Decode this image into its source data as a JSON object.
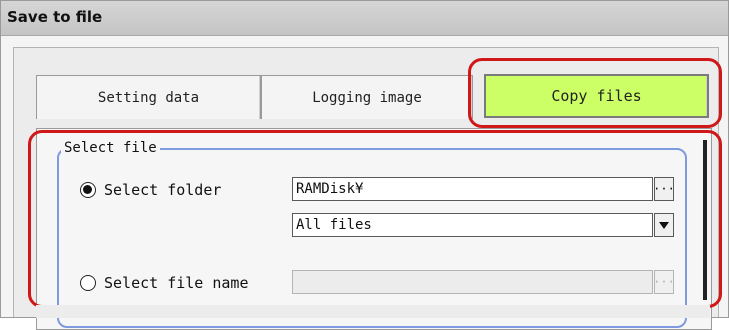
{
  "window": {
    "title": "Save to file"
  },
  "tabs": [
    {
      "label": "Setting data",
      "active": false
    },
    {
      "label": "Logging image",
      "active": false
    },
    {
      "label": "Copy files",
      "active": true
    }
  ],
  "select_file": {
    "legend": "Select file",
    "select_folder": {
      "label": "Select folder",
      "checked": true,
      "folder_value": "RAMDisk¥",
      "file_type_value": "All files",
      "browse_label": "···"
    },
    "select_file_name": {
      "label": "Select file name",
      "checked": false,
      "value": "",
      "browse_label": "···"
    }
  },
  "colors": {
    "active_tab": "#ccff66",
    "highlight": "#d01818",
    "group_border": "#7f9be0"
  }
}
